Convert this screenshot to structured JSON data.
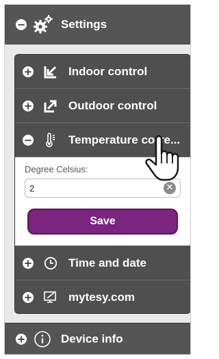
{
  "header": {
    "toggle": "−",
    "label": "Settings",
    "icon": "gear-icon"
  },
  "panel": {
    "items": [
      {
        "toggle": "+",
        "label": "Indoor control",
        "icon": "indoor-arrow-icon"
      },
      {
        "toggle": "+",
        "label": "Outdoor control",
        "icon": "outdoor-arrow-icon"
      },
      {
        "toggle": "−",
        "label": "Temperature corre...",
        "icon": "thermometer-icon"
      }
    ],
    "expanded": {
      "field_label": "Degree Celsius:",
      "field_value": "2",
      "clear_symbol": "✕",
      "save_label": "Save"
    },
    "items_after": [
      {
        "toggle": "+",
        "label": "Time and date",
        "icon": "clock-icon"
      },
      {
        "toggle": "+",
        "label": "mytesy.com",
        "icon": "monitor-icon"
      }
    ]
  },
  "device": {
    "toggle": "+",
    "label": "Device info",
    "icon": "info-icon"
  },
  "colors": {
    "header_bg": "#555555",
    "panel_bg": "#4f4f4f",
    "save_bg": "#7b2480"
  }
}
